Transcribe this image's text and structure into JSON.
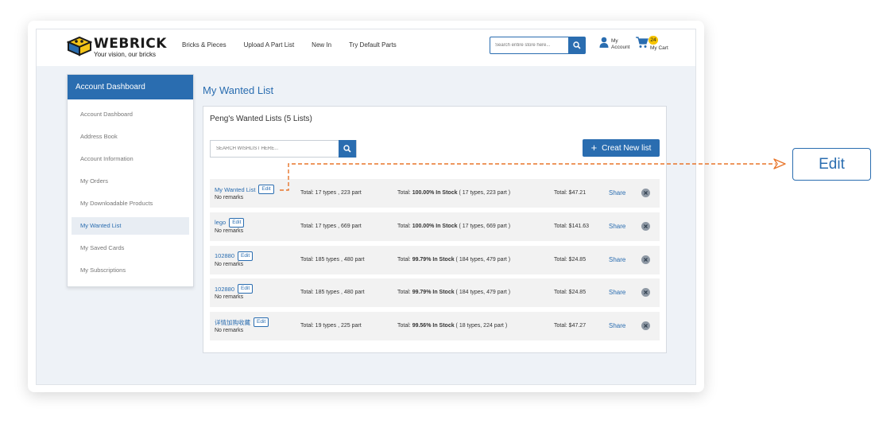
{
  "header": {
    "logo_name": "WEBRICK",
    "logo_tagline": "Your vision, our bricks",
    "nav": [
      "Bricks & Pieces",
      "Upload A Part List",
      "New In",
      "Try Default Parts"
    ],
    "search_placeholder": "Search entire store here...",
    "account_line1": "My",
    "account_line2": "Account",
    "cart_label": "My Cart",
    "cart_count": "24"
  },
  "sidebar": {
    "title": "Account Dashboard",
    "items": [
      "Account Dashboard",
      "Address Book",
      "Account Information",
      "My Orders",
      "My Downloadable Products",
      "My Wanted List",
      "My Saved Cards",
      "My Subscriptions"
    ],
    "active_index": 5
  },
  "main": {
    "page_title": "My Wanted List",
    "panel_title": "Peng's Wanted Lists (5 Lists)",
    "search_placeholder": "SEARCH WISHLIST HERE...",
    "create_label": "Creat New list",
    "edit_label": "Edit",
    "share_label": "Share",
    "rows": [
      {
        "name": "My Wanted List",
        "remark": "No remarks",
        "types": "Total: 17 types , 223 part",
        "stock_prefix": "Total: ",
        "stock_pct": "100.00% In Stock",
        "stock_detail": " ( 17 types, 223 part )",
        "price": "Total: $47.21"
      },
      {
        "name": "lego",
        "remark": "No remarks",
        "types": "Total: 17 types , 669 part",
        "stock_prefix": "Total: ",
        "stock_pct": "100.00% In Stock",
        "stock_detail": " ( 17 types, 669 part )",
        "price": "Total: $141.63"
      },
      {
        "name": "102880",
        "remark": "No remarks",
        "types": "Total: 185 types , 480 part",
        "stock_prefix": "Total: ",
        "stock_pct": "99.79% In Stock",
        "stock_detail": " ( 184 types, 479 part )",
        "price": "Total: $24.85"
      },
      {
        "name": "102880",
        "remark": "No remarks",
        "types": "Total: 185 types , 480 part",
        "stock_prefix": "Total: ",
        "stock_pct": "99.79% In Stock",
        "stock_detail": " ( 184 types, 479 part )",
        "price": "Total: $24.85"
      },
      {
        "name": "详情加购收藏",
        "remark": "No remarks",
        "types": "Total: 19 types , 225 part",
        "stock_prefix": "Total: ",
        "stock_pct": "99.56% In Stock",
        "stock_detail": " ( 18 types, 224 part )",
        "price": "Total: $47.27"
      }
    ]
  },
  "callout": {
    "label": "Edit",
    "accent_color": "#e8752a"
  },
  "colors": {
    "primary": "#2a6db0",
    "page_bg": "#eef2f7",
    "row_bg": "#f2f2f2"
  }
}
